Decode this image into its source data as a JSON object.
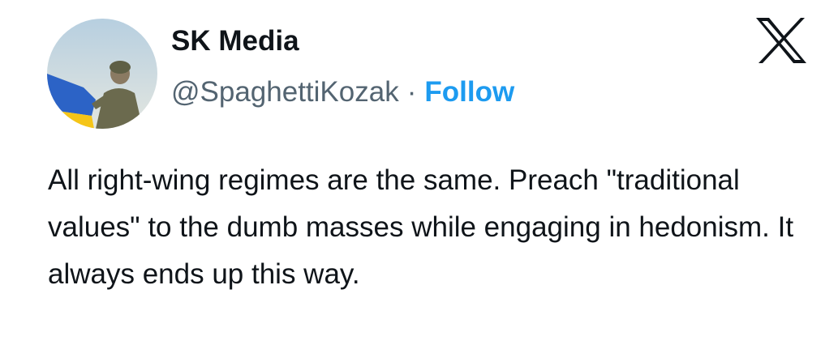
{
  "author": {
    "display_name": "SK Media",
    "handle": "@SpaghettiKozak",
    "separator": "·",
    "follow_label": "Follow",
    "avatar_icon": "avatar-soldier-with-ukrainian-flag"
  },
  "tweet": {
    "text": "All right-wing regimes are the same. Preach \"traditional values\" to the dumb masses while engaging in hedonism. It always ends up this way."
  },
  "brand": {
    "logo_icon": "x-logo-icon"
  },
  "colors": {
    "text_primary": "#0f1419",
    "text_secondary": "#536471",
    "accent_blue": "#1d9bf0",
    "flag_blue": "#2c63c6",
    "flag_yellow": "#f5c518"
  }
}
